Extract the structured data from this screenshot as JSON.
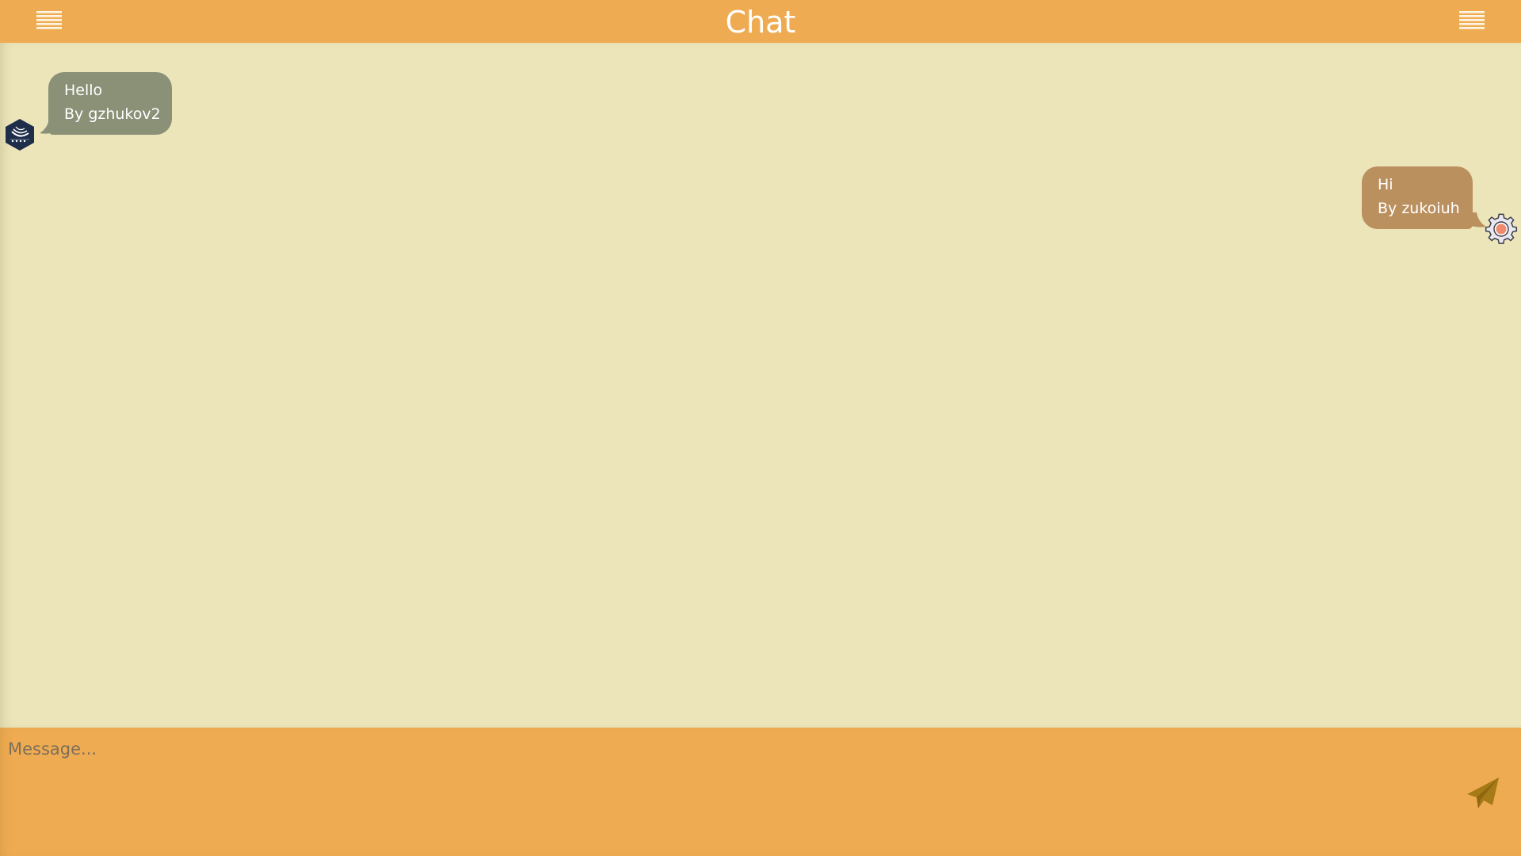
{
  "header": {
    "title": "Chat",
    "left_menu_icon": "hamburger-menu-icon",
    "right_menu_icon": "hamburger-menu-icon"
  },
  "messages": [
    {
      "text": "Hello",
      "byline": "By gzhukov2",
      "side": "left",
      "avatar_icon": "jquery-logo-icon",
      "bubble_color": "#8a9177"
    },
    {
      "text": "Hi",
      "byline": "By zukoiuh",
      "side": "right",
      "avatar_icon": "gear-icon",
      "bubble_color": "#bb905f"
    }
  ],
  "composer": {
    "placeholder": "Message...",
    "value": "",
    "send_icon": "paper-plane-icon"
  },
  "colors": {
    "header_bg": "#efab51",
    "chat_bg": "#ece5b9",
    "composer_bg": "#efab51",
    "send_icon": "#a67a16"
  }
}
